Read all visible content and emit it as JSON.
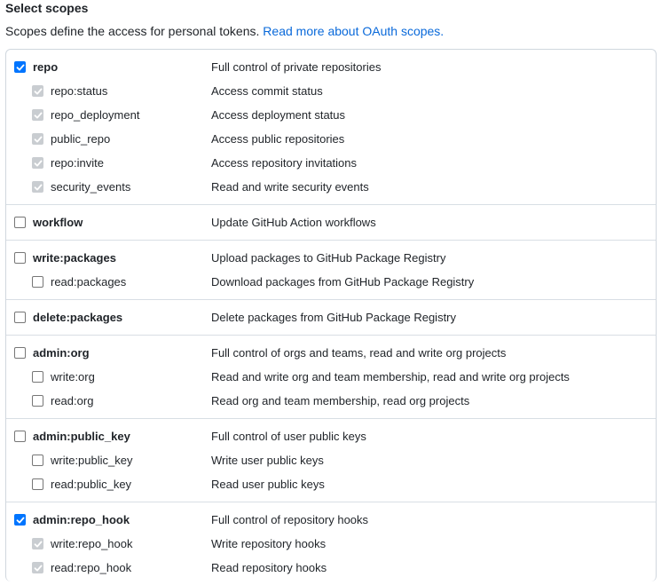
{
  "heading": "Select scopes",
  "description": {
    "text": "Scopes define the access for personal tokens.",
    "link": "Read more about OAuth scopes."
  },
  "groups": [
    {
      "parent": {
        "name": "repo",
        "desc": "Full control of private repositories",
        "checked": true
      },
      "children": [
        {
          "name": "repo:status",
          "desc": "Access commit status",
          "state": "disabled-checked"
        },
        {
          "name": "repo_deployment",
          "desc": "Access deployment status",
          "state": "disabled-checked"
        },
        {
          "name": "public_repo",
          "desc": "Access public repositories",
          "state": "disabled-checked"
        },
        {
          "name": "repo:invite",
          "desc": "Access repository invitations",
          "state": "disabled-checked"
        },
        {
          "name": "security_events",
          "desc": "Read and write security events",
          "state": "disabled-checked"
        }
      ]
    },
    {
      "parent": {
        "name": "workflow",
        "desc": "Update GitHub Action workflows",
        "checked": false
      },
      "children": []
    },
    {
      "parent": {
        "name": "write:packages",
        "desc": "Upload packages to GitHub Package Registry",
        "checked": false
      },
      "children": [
        {
          "name": "read:packages",
          "desc": "Download packages from GitHub Package Registry",
          "state": "unchecked"
        }
      ]
    },
    {
      "parent": {
        "name": "delete:packages",
        "desc": "Delete packages from GitHub Package Registry",
        "checked": false
      },
      "children": []
    },
    {
      "parent": {
        "name": "admin:org",
        "desc": "Full control of orgs and teams, read and write org projects",
        "checked": false
      },
      "children": [
        {
          "name": "write:org",
          "desc": "Read and write org and team membership, read and write org projects",
          "state": "unchecked"
        },
        {
          "name": "read:org",
          "desc": "Read org and team membership, read org projects",
          "state": "unchecked"
        }
      ]
    },
    {
      "parent": {
        "name": "admin:public_key",
        "desc": "Full control of user public keys",
        "checked": false
      },
      "children": [
        {
          "name": "write:public_key",
          "desc": "Write user public keys",
          "state": "unchecked"
        },
        {
          "name": "read:public_key",
          "desc": "Read user public keys",
          "state": "unchecked"
        }
      ]
    },
    {
      "parent": {
        "name": "admin:repo_hook",
        "desc": "Full control of repository hooks",
        "checked": true
      },
      "children": [
        {
          "name": "write:repo_hook",
          "desc": "Write repository hooks",
          "state": "disabled-checked"
        },
        {
          "name": "read:repo_hook",
          "desc": "Read repository hooks",
          "state": "disabled-checked"
        }
      ]
    }
  ],
  "colors": {
    "checked": "#0075ff",
    "disabled_checked": "#c9cdd1",
    "link": "#0969da",
    "border": "#d0d7de"
  }
}
